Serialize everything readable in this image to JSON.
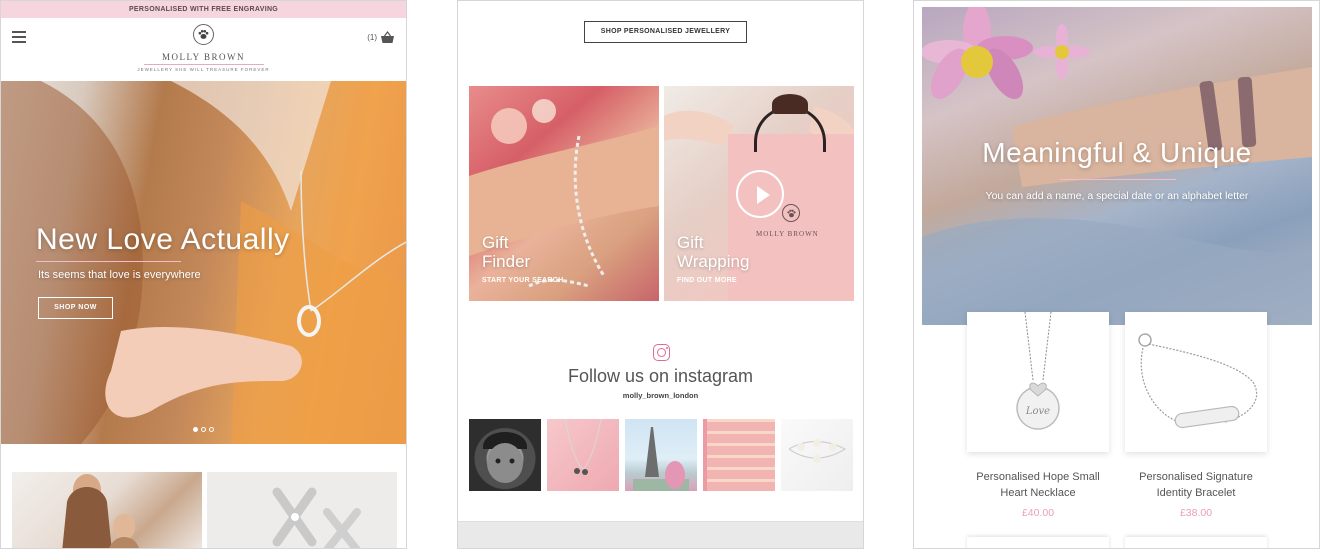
{
  "screen1": {
    "promo_text": "PERSONALISED WITH FREE ENGRAVING",
    "logo_name": "MOLLY BROWN",
    "logo_tagline": "JEWELLERY SHE WILL TREASURE FOREVER",
    "cart_count": "(1)",
    "hero": {
      "title": "New Love Actually",
      "subtitle": "Its seems that love is everywhere",
      "cta": "SHOP NOW"
    }
  },
  "screen2": {
    "top_button": "SHOP PERSONALISED JEWELLERY",
    "tiles": [
      {
        "title_line1": "Gift",
        "title_line2": "Finder",
        "cta": "START YOUR SEARCH"
      },
      {
        "title_line1": "Gift",
        "title_line2": "Wrapping",
        "cta": "FIND OUT MORE"
      }
    ],
    "bag_logo": "MOLLY BROWN",
    "instagram": {
      "heading": "Follow us on instagram",
      "handle": "molly_brown_london"
    }
  },
  "screen3": {
    "hero": {
      "title": "Meaningful & Unique",
      "subtitle": "You can add a name, a special date or an alphabet letter"
    },
    "products": [
      {
        "name_line1": "Personalised Hope Small",
        "name_line2": "Heart Necklace",
        "price": "£40.00",
        "engraving": "Love"
      },
      {
        "name_line1": "Personalised Signature",
        "name_line2": "Identity Bracelet",
        "price": "£38.00"
      }
    ]
  },
  "colors": {
    "promo_bg": "#f6d5df",
    "accent_pink": "#e8a0b6",
    "instagram_pink": "#e06a94"
  }
}
